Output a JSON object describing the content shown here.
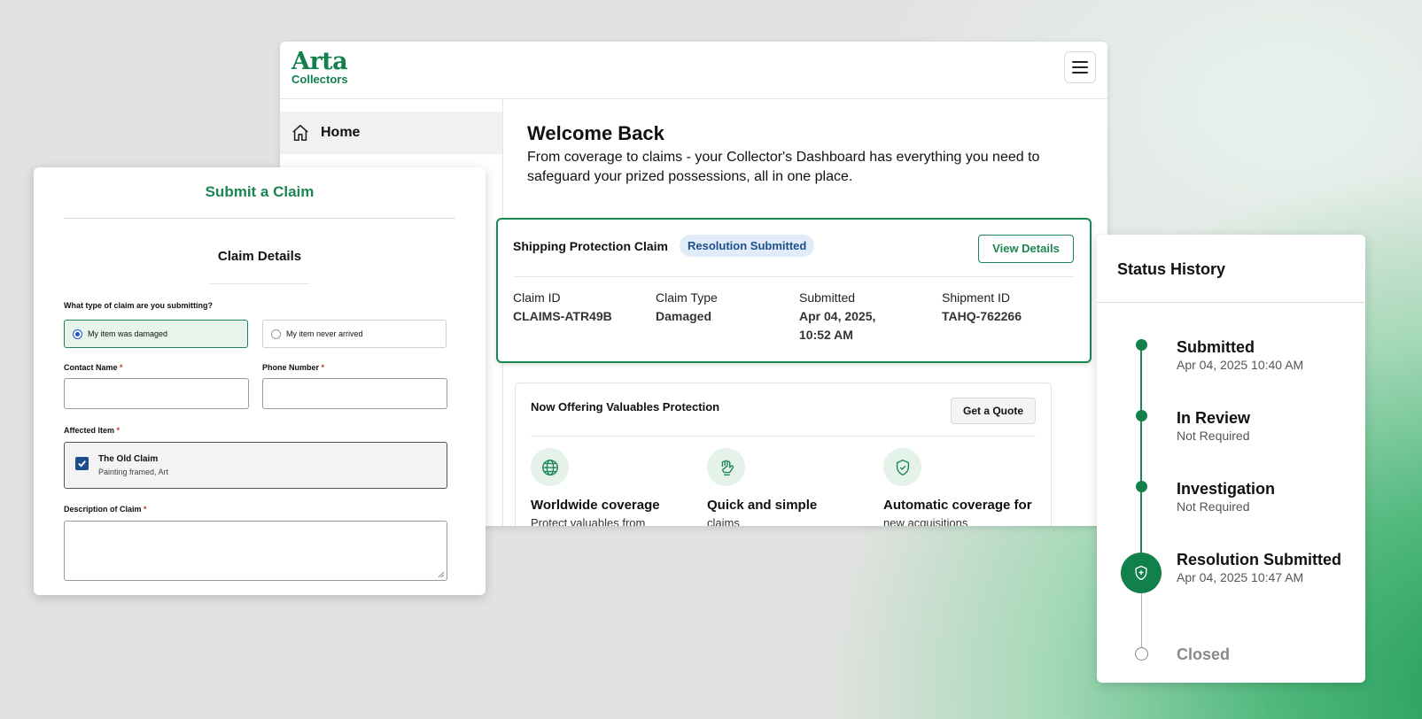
{
  "header": {
    "logo_main": "Arta",
    "logo_sub": "Collectors",
    "menu_icon": "hamburger-icon"
  },
  "sidebar": {
    "items": [
      {
        "label": "Home",
        "icon": "home-icon"
      }
    ]
  },
  "welcome": {
    "title": "Welcome Back",
    "subtitle": "From coverage to claims - your Collector's Dashboard has everything you need to safeguard your prized possessions, all in one place."
  },
  "claim_card": {
    "title": "Shipping Protection Claim",
    "badge": "Resolution Submitted",
    "view_button": "View Details",
    "fields": [
      {
        "label": "Claim ID",
        "value": "CLAIMS-ATR49B"
      },
      {
        "label": "Claim Type",
        "value": "Damaged"
      },
      {
        "label": "Submitted",
        "value": "Apr 04, 2025,",
        "value2": "10:52 AM"
      },
      {
        "label": "Shipment ID",
        "value": "TAHQ-762266"
      }
    ]
  },
  "offer": {
    "title": "Now Offering Valuables Protection",
    "quote_button": "Get a Quote",
    "features": [
      {
        "title": "Worldwide coverage",
        "desc": "Protect valuables from",
        "icon": "globe-icon"
      },
      {
        "title": "Quick and simple",
        "desc": "claims",
        "icon": "hand-icon"
      },
      {
        "title": "Automatic coverage for",
        "desc": "new acquisitions",
        "icon": "shield-check-icon"
      }
    ]
  },
  "claim_form": {
    "title": "Submit a Claim",
    "section": "Claim Details",
    "question": "What type of claim are you submitting?",
    "options": [
      "My item was damaged",
      "My item never arrived"
    ],
    "selected": "My item was damaged",
    "contact_label": "Contact Name",
    "phone_label": "Phone Number",
    "affected_label": "Affected Item",
    "item_name": "The Old Claim",
    "item_desc": "Painting framed, Art",
    "description_label": "Description of Claim",
    "required_mark": "*",
    "contact_value": "",
    "phone_value": "",
    "description_value": ""
  },
  "status_history": {
    "title": "Status History",
    "steps": [
      {
        "name": "Submitted",
        "detail": "Apr 04, 2025 10:40 AM"
      },
      {
        "name": "In Review",
        "detail": "Not Required"
      },
      {
        "name": "Investigation",
        "detail": "Not Required"
      },
      {
        "name": "Resolution Submitted",
        "detail": "Apr 04, 2025 10:47 AM"
      },
      {
        "name": "Closed",
        "detail": ""
      }
    ]
  },
  "colors": {
    "brand_green": "#12804a",
    "badge_bg": "#e2ecf8",
    "badge_text": "#1c4f8a"
  }
}
